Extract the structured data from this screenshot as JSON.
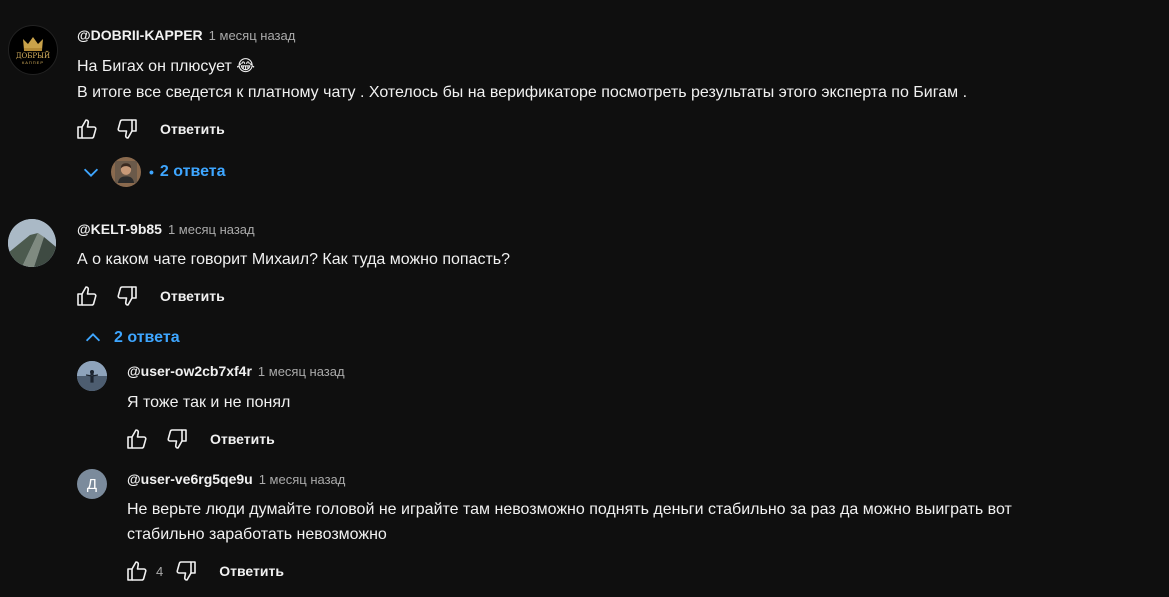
{
  "comments": [
    {
      "author": "@DOBRII-KAPPER",
      "time": "1 месяц назад",
      "line1": "На Бигах он плюсует 😂",
      "line2": "В итоге все сведется к платному чату . Хотелось бы на верификаторе посмотреть результаты этого эксперта по Бигам .",
      "reply_label": "Ответить",
      "replies_label": "2 ответа",
      "avatar_text": "ДОБРЫЙ",
      "avatar_subtext": "КАППЕР"
    },
    {
      "author": "@KELT-9b85",
      "time": "1 месяц назад",
      "line1": "А о каком чате говорит Михаил? Как туда можно попасть?",
      "reply_label": "Ответить",
      "replies_label": "2 ответа"
    }
  ],
  "replies": [
    {
      "author": "@user-ow2cb7xf4r",
      "time": "1 месяц назад",
      "line1": "Я тоже так и не понял",
      "reply_label": "Ответить"
    },
    {
      "author": "@user-ve6rg5qe9u",
      "time": "1 месяц назад",
      "line1": "Не верьте люди думайте головой не играйте там невозможно поднять деньги стабильно за раз да можно выиграть вот",
      "line2": "стабильно заработать невозможно",
      "likes": "4",
      "reply_label": "Ответить",
      "avatar_letter": "Д"
    }
  ],
  "colors": {
    "background": "#0f0f0f",
    "text": "#f1f1f1",
    "secondary_text": "#aaaaaa",
    "link_blue": "#3ea6ff",
    "avatar_letter_bg": "#7b8b9c"
  }
}
